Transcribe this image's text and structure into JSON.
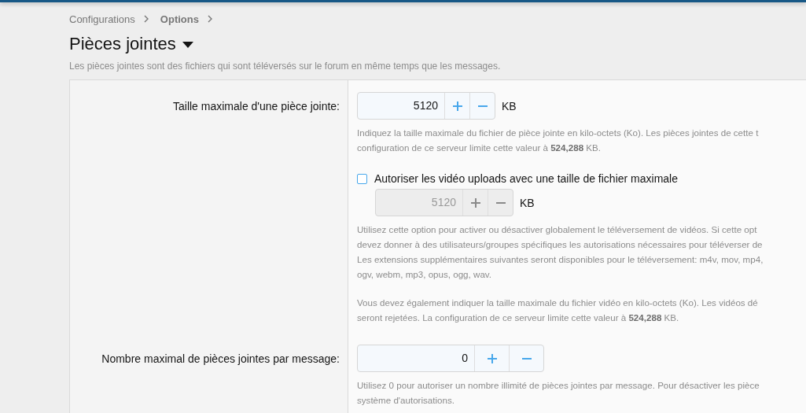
{
  "breadcrumb": [
    {
      "label": "Configurations",
      "current": false
    },
    {
      "label": "Options",
      "current": true
    }
  ],
  "title": "Pièces jointes",
  "description": "Les pièces jointes sont des fichiers qui sont téléversés sur le forum en même temps que les messages.",
  "rows": [
    {
      "kind": "number",
      "label": "Taille maximale d'une pièce jointe:",
      "value": "5120",
      "unit": "KB",
      "disabled": false,
      "help": [
        [
          "Indiquez la taille maximale du fichier de pièce jointe en kilo-octets (Ko). Les pièces jointes de cette t",
          "configuration de ce serveur limite cette valeur à **524,288** KB."
        ]
      ]
    },
    {
      "kind": "checkbox",
      "label": "Autoriser les vidéo uploads avec une taille de fichier maximale",
      "checked": false,
      "value": "5120",
      "unit": "KB",
      "disabled": true,
      "help": [
        [
          "Utilisez cette option pour activer ou désactiver globalement le téléversement de vidéos. Si cette opt",
          "devez donner à des utilisateurs/groupes spécifiques les autorisations nécessaires pour téléverser de",
          "Les extensions supplémentaires suivantes seront disponibles pour le téléversement: m4v, mov, mp4,",
          "ogv, webm, mp3, opus, ogg, wav."
        ],
        [
          "Vous devez également indiquer la taille maximale du fichier vidéo en kilo-octets (Ko). Les vidéos dé",
          "seront rejetées. La configuration de ce serveur limite cette valeur à **524,288** KB."
        ]
      ]
    },
    {
      "kind": "number",
      "label": "Nombre maximal de pièces jointes par message:",
      "value": "0",
      "disabled": false,
      "help": [
        [
          "Utilisez 0 pour autoriser un nombre illimité de pièces jointes par message. Pour désactiver les pièce",
          "système d'autorisations."
        ]
      ]
    }
  ]
}
